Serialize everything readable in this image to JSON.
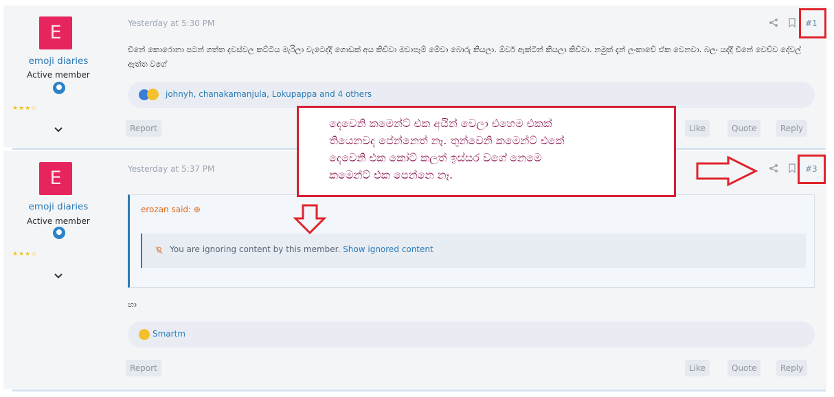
{
  "posts": [
    {
      "avatar_letter": "E",
      "username": "emoji diaries",
      "user_title": "Active member",
      "stars": "★★★☆",
      "date": "Yesterday at 5:30 PM",
      "number": "#1",
      "body": "චීනේ කොරොනා පටන් ගත්ත දවස්වල කට්ටිය මැරිලා වැටෙද්දි ගොඩක් අය කිව්වා මවාපෑම් මේවා බොරු කියලා. ඕවර් ඇක්ටින් කියලා කිව්වා. නමුත් දැන් ලංකාවේ ඒක වෙනවා. බලං යද්දි චීනේ වෙච්ච දේවල් ඇත්ත වගේ",
      "reactions_text": "johnyh, chanakamanjula, Lokupappa and 4 others",
      "actions": {
        "report": "Report",
        "like": "Like",
        "quote": "Quote",
        "reply": "Reply"
      }
    },
    {
      "avatar_letter": "E",
      "username": "emoji diaries",
      "user_title": "Active member",
      "stars": "★★★☆",
      "date": "Yesterday at 5:37 PM",
      "number": "#3",
      "quote_author": "erozan said: ⊕",
      "quote_ignore": "You are ignoring content by this member.",
      "quote_link": "Show ignored content",
      "body": "හා",
      "reactions_text": "Smartm",
      "actions": {
        "report": "Report",
        "like": "Like",
        "quote": "Quote",
        "reply": "Reply"
      }
    }
  ],
  "annotation": {
    "lines": [
      "දෙවෙනි කමෙන්ට් එක අයින් වෙලා එහෙම එකක්",
      "තියෙනවද පේන්නෙත් නෑ. තුන්වෙනි කමෙන්ට් එකේ",
      "දෙවෙනි එක කෝට් කලත් ඉස්සර වගේ නෙමෙ",
      "කමෙන්ට් එක පෙන්නෙ නෑ."
    ],
    "color": "#8e1b57",
    "box_color": "#d61f33"
  },
  "colors": {
    "accent": "#2b7bb5",
    "avatar_bg": "#e6245d",
    "highlight": "#e0232b"
  }
}
